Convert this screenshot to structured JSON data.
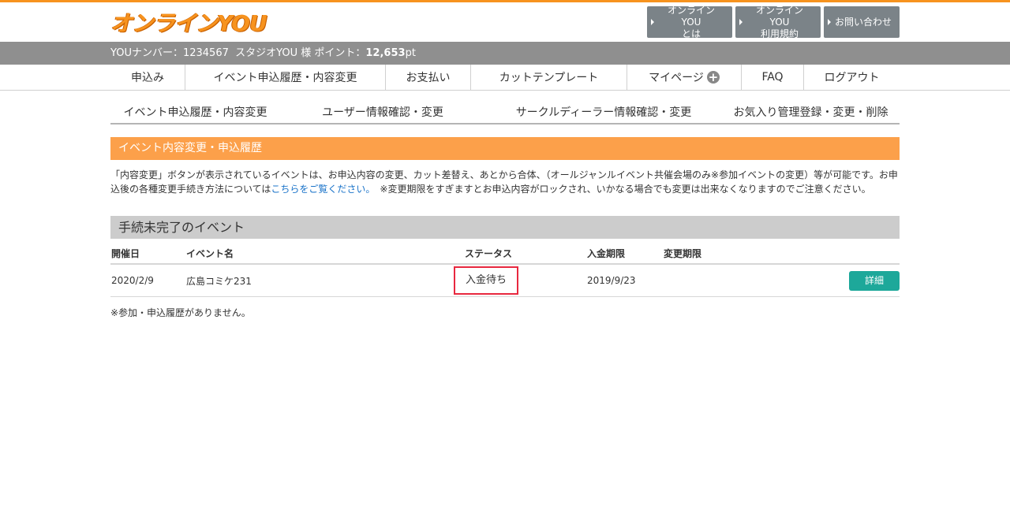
{
  "logo": "オンラインYOU",
  "top_buttons": [
    "オンラインYOU\nとは",
    "オンラインYOU\n利用規約",
    "お問い合わせ"
  ],
  "userbar": {
    "prefix": "YOUナンバー：1234567  スタジオYOU 様 ポイント：",
    "points": "12,653",
    "unit": "pt"
  },
  "main_nav": [
    "申込み",
    "イベント申込履歴・内容変更",
    "お支払い",
    "カットテンプレート",
    "マイページ",
    "FAQ",
    "ログアウト"
  ],
  "sub_nav": [
    "イベント申込履歴・内容変更",
    "ユーザー情報確認・変更",
    "サークルディーラー情報確認・変更",
    "お気入り管理登録・変更・削除"
  ],
  "section_title": "イベント内容変更・申込履歴",
  "description": {
    "part1": "「内容変更」ボタンが表示されているイベントは、お申込内容の変更、カット差替え、あとから合体、（オールジャンルイベント共催会場のみ※参加イベントの変更）等が可能です。お申込後の各種変更手続き方法については",
    "link": "こちらをご覧ください。",
    "part2": "　※変更期限をすぎますとお申込内容がロックされ、いかなる場合でも変更は出来なくなりますのでご注意ください。"
  },
  "pending_title": "手続未完了のイベント",
  "table": {
    "headers": [
      "開催日",
      "イベント名",
      "ステータス",
      "入金期限",
      "変更期限"
    ],
    "rows": [
      {
        "date": "2020/2/9",
        "event": "広島コミケ231",
        "status": "入金待ち",
        "payment_deadline": "2019/9/23",
        "change_deadline": "",
        "action": "詳細"
      }
    ]
  },
  "empty_note": "※参加・申込履歴がありません。",
  "colors": {
    "accent": "#f7931e",
    "section": "#fca04a",
    "detail_button": "#1da89a",
    "highlight": "#e8283f"
  }
}
